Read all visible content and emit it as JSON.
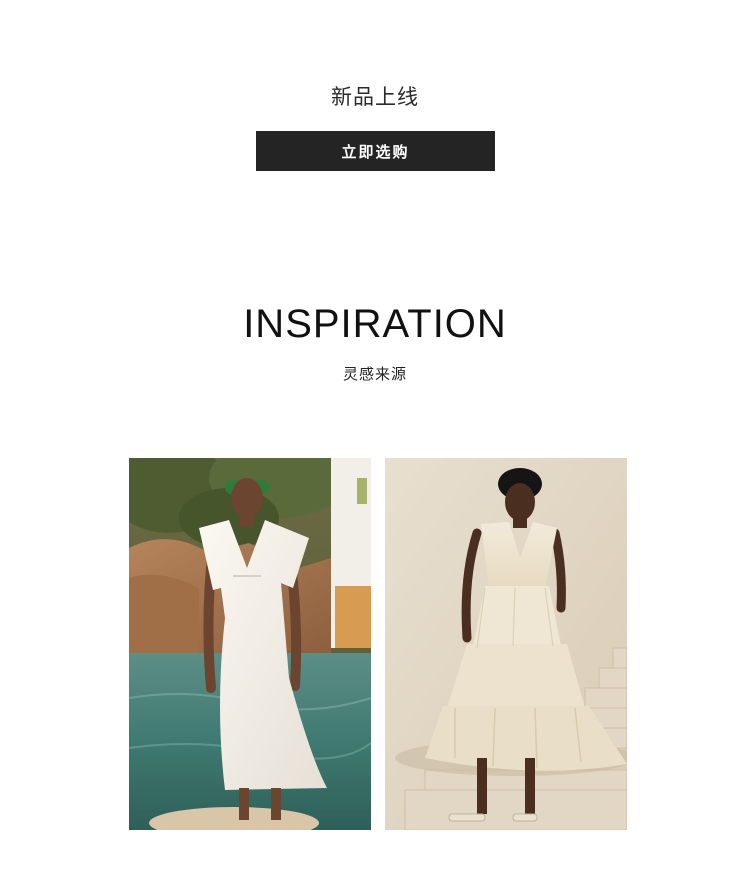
{
  "promo": {
    "title": "新品上线",
    "button_label": "立即选购"
  },
  "inspiration": {
    "heading": "INSPIRATION",
    "subtitle": "灵感来源"
  },
  "photos": [
    {
      "name": "model-seaside-photo"
    },
    {
      "name": "model-stairs-photo"
    }
  ],
  "colors": {
    "button_bg": "#242424",
    "button_text": "#ffffff",
    "heading_text": "#111111"
  }
}
